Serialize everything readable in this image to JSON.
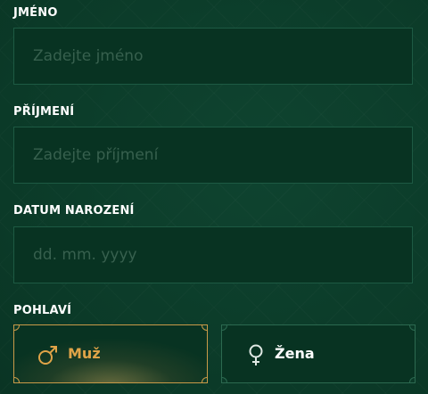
{
  "form": {
    "first_name": {
      "label": "JMÉNO",
      "placeholder": "Zadejte jméno",
      "value": ""
    },
    "last_name": {
      "label": "PŘÍJMENÍ",
      "placeholder": "Zadejte příjmení",
      "value": ""
    },
    "birth_date": {
      "label": "DATUM NAROZENÍ",
      "placeholder": "dd. mm. yyyy",
      "value": ""
    },
    "gender": {
      "label": "POHLAVÍ",
      "options": [
        {
          "label": "Muž",
          "icon": "male-symbol-icon",
          "selected": true
        },
        {
          "label": "Žena",
          "icon": "female-symbol-icon",
          "selected": false
        }
      ]
    }
  },
  "colors": {
    "background": "#0c3d2a",
    "input_background": "#083322",
    "input_border": "#1d5a43",
    "placeholder": "#37604e",
    "label": "#ffffff",
    "accent_gold": "#e0a448",
    "selected_border": "#c99a48",
    "unselected_border": "#2c6950"
  }
}
